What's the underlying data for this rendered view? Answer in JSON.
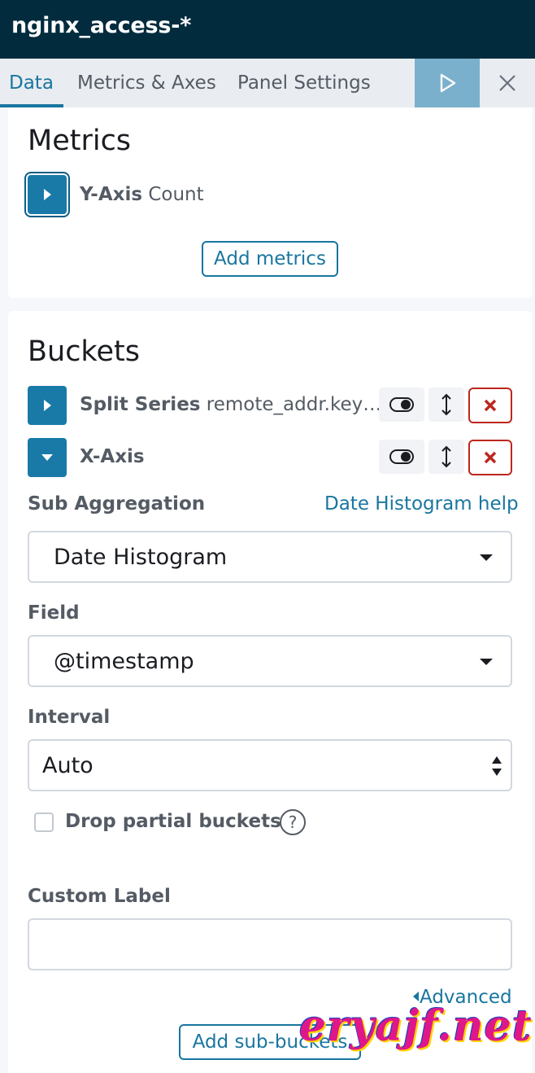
{
  "header": {
    "title": "nginx_access-*"
  },
  "tabs": [
    {
      "label": "Data",
      "active": true
    },
    {
      "label": "Metrics & Axes",
      "active": false
    },
    {
      "label": "Panel Settings",
      "active": false
    }
  ],
  "toolbar": {
    "apply_icon": "play-icon",
    "close_icon": "close-icon"
  },
  "metrics": {
    "heading": "Metrics",
    "items": [
      {
        "type": "Y-Axis",
        "name": "Count",
        "expanded": false
      }
    ],
    "add_button": "Add metrics"
  },
  "buckets": {
    "heading": "Buckets",
    "items": [
      {
        "type": "Split Series",
        "name": "remote_addr.key…",
        "expanded": false
      },
      {
        "type": "X-Axis",
        "name": "",
        "expanded": true
      }
    ],
    "x_axis_editor": {
      "sub_aggregation_label": "Sub Aggregation",
      "help_link": "Date Histogram help",
      "sub_aggregation_value": "Date Histogram",
      "field_label": "Field",
      "field_value": "@timestamp",
      "interval_label": "Interval",
      "interval_value": "Auto",
      "drop_partial_label": "Drop partial buckets",
      "drop_partial_checked": false,
      "custom_label_label": "Custom Label",
      "custom_label_value": "",
      "advanced_link": "Advanced"
    },
    "add_button": "Add sub-buckets"
  },
  "watermark": "eryajf.net",
  "colors": {
    "header_bg": "#022c3e",
    "accent": "#1976a0",
    "danger": "#bd271e",
    "apply_bg": "#7ab0cb"
  }
}
